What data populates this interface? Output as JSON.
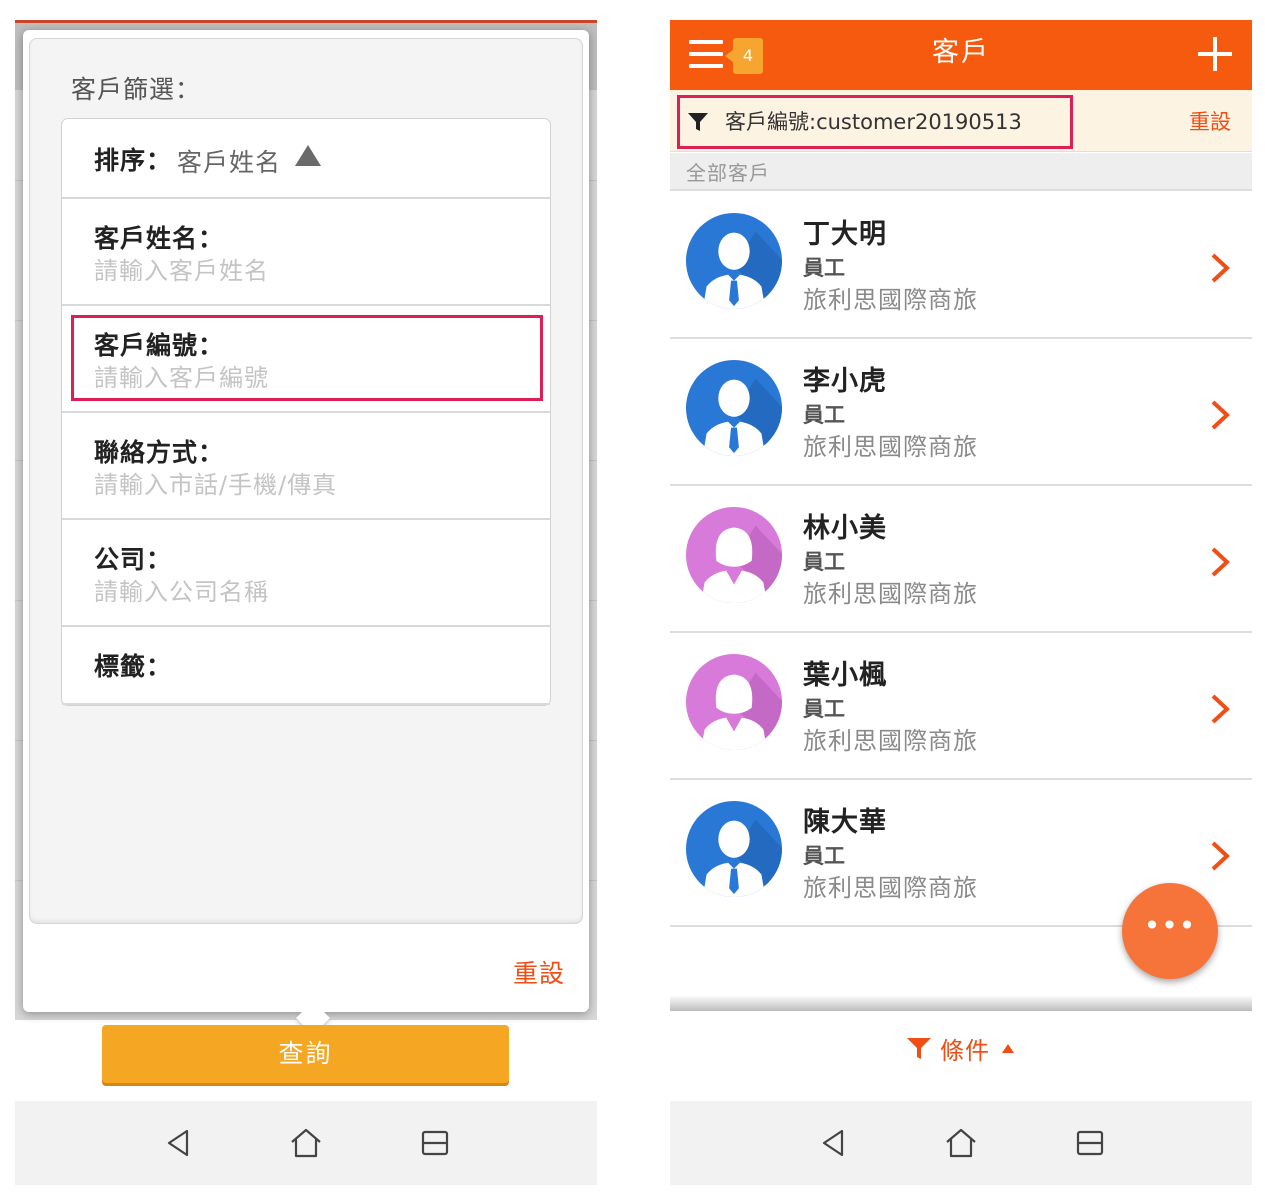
{
  "left": {
    "filter_title": "客戶篩選：",
    "sort": {
      "label": "排序：",
      "value": "客戶姓名"
    },
    "fields": [
      {
        "label": "客戶姓名：",
        "placeholder": "請輸入客戶姓名"
      },
      {
        "label": "客戶編號：",
        "placeholder": "請輸入客戶編號"
      },
      {
        "label": "聯絡方式：",
        "placeholder": "請輸入市話/手機/傳真"
      },
      {
        "label": "公司：",
        "placeholder": "請輸入公司名稱"
      },
      {
        "label": "標籤："
      }
    ],
    "reset_label": "重設",
    "query_label": "查詢"
  },
  "right": {
    "header": {
      "badge": "4",
      "title": "客戶"
    },
    "filter_bar": {
      "text": "客戶編號:customer20190513",
      "reset_label": "重設"
    },
    "section_label": "全部客戶",
    "customers": [
      {
        "name": "丁大明",
        "role": "員工",
        "company": "旅利思國際商旅",
        "avatar": "male-avatar-icon"
      },
      {
        "name": "李小虎",
        "role": "員工",
        "company": "旅利思國際商旅",
        "avatar": "male-avatar-icon"
      },
      {
        "name": "林小美",
        "role": "員工",
        "company": "旅利思國際商旅",
        "avatar": "female-avatar-icon"
      },
      {
        "name": "葉小楓",
        "role": "員工",
        "company": "旅利思國際商旅",
        "avatar": "female-avatar-icon"
      },
      {
        "name": "陳大華",
        "role": "員工",
        "company": "旅利思國際商旅",
        "avatar": "male-avatar-icon"
      }
    ],
    "fab_label": "•••",
    "condition_label": "條件"
  },
  "colors": {
    "brand_orange": "#f55a0e",
    "accent_text": "#f04e14",
    "query_button": "#f5a623",
    "highlight": "#dc1f55",
    "male_avatar": "#2a78d6",
    "female_avatar": "#d77ad9"
  }
}
